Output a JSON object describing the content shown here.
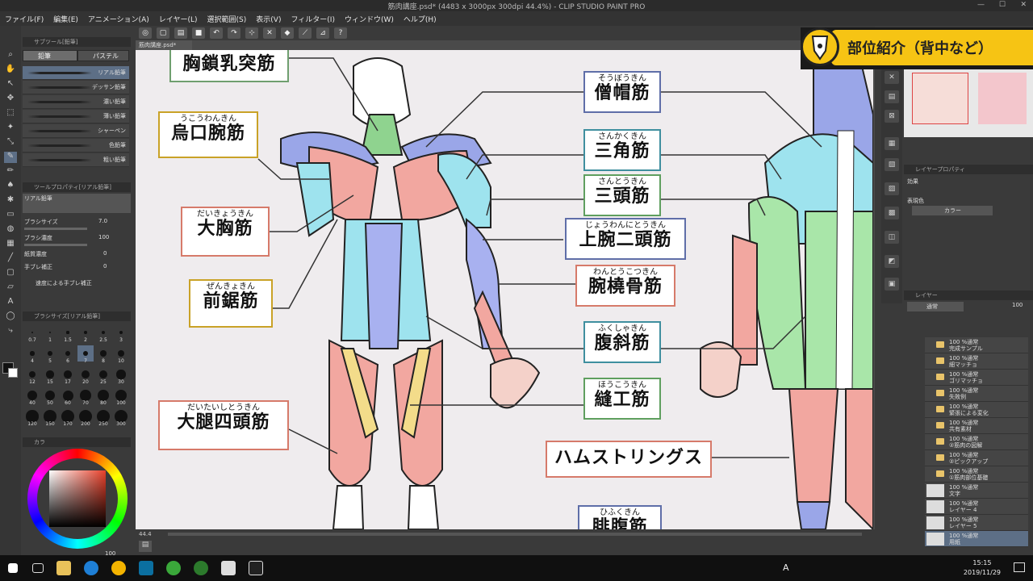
{
  "window": {
    "title": "筋肉講座.psd* (4483 x 3000px 300dpi 44.4%) - CLIP STUDIO PAINT PRO",
    "controls": [
      "—",
      "☐",
      "✕"
    ]
  },
  "menu": [
    "ファイル(F)",
    "編集(E)",
    "アニメーション(A)",
    "レイヤー(L)",
    "選択範囲(S)",
    "表示(V)",
    "フィルター(I)",
    "ウィンドウ(W)",
    "ヘルプ(H)"
  ],
  "subtool_panel": {
    "header": "サブツール[鉛筆]",
    "tabs": [
      "鉛筆",
      "パステル"
    ],
    "brushes": [
      "リアル鉛筆",
      "デッサン鉛筆",
      "濃い鉛筆",
      "薄い鉛筆",
      "シャーペン",
      "色鉛筆",
      "粗い鉛筆"
    ],
    "selected_brush": 0
  },
  "tool_property": {
    "header": "ツールプロパティ[リアル鉛筆]",
    "brush_name": "リアル鉛筆",
    "props": [
      {
        "label": "ブラシサイズ",
        "value": "7.0"
      },
      {
        "label": "ブラシ濃度",
        "value": "100"
      },
      {
        "label": "紙質濃度",
        "value": "0"
      },
      {
        "label": "手ブレ補正",
        "value": "0"
      }
    ],
    "checkbox_label": "速度による手ブレ補正"
  },
  "brush_size": {
    "header": "ブラシサイズ[リアル鉛筆]",
    "sizes": [
      "0.7",
      "1",
      "1.5",
      "2",
      "2.5",
      "3",
      "4",
      "5",
      "6",
      "7",
      "8",
      "10",
      "12",
      "15",
      "17",
      "20",
      "25",
      "30",
      "40",
      "50",
      "60",
      "70",
      "80",
      "100",
      "120",
      "150",
      "170",
      "200",
      "250",
      "300"
    ],
    "selected_index": 9
  },
  "color_panel": {
    "header": "カラ",
    "opacity": "100"
  },
  "document_tab": "筋肉講座.psd*",
  "banner": {
    "text": "部位紹介（背中など）"
  },
  "canvas": {
    "labels": [
      {
        "id": "kyosa",
        "ruby": "",
        "kanji": "胸鎖乳突筋",
        "color": "#6f9f6f"
      },
      {
        "id": "uko",
        "ruby": "うこうわんきん",
        "kanji": "烏口腕筋",
        "color": "#c9a227"
      },
      {
        "id": "daikyo",
        "ruby": "だいきょうきん",
        "kanji": "大胸筋",
        "color": "#d67a6a"
      },
      {
        "id": "zenkyo",
        "ruby": "ぜんきょきん",
        "kanji": "前鋸筋",
        "color": "#c9a227"
      },
      {
        "id": "daitai",
        "ruby": "だいたいしとうきん",
        "kanji": "大腿四頭筋",
        "color": "#d67a6a"
      },
      {
        "id": "sobo",
        "ruby": "そうぼうきん",
        "kanji": "僧帽筋",
        "color": "#5f6ea8"
      },
      {
        "id": "sankaku",
        "ruby": "さんかくきん",
        "kanji": "三角筋",
        "color": "#3f8f9f"
      },
      {
        "id": "santo",
        "ruby": "さんとうきん",
        "kanji": "三頭筋",
        "color": "#5f9f5f"
      },
      {
        "id": "jowan",
        "ruby": "じょうわんにとうきん",
        "kanji": "上腕二頭筋",
        "color": "#5f6ea8"
      },
      {
        "id": "wanto",
        "ruby": "わんとうこつきん",
        "kanji": "腕橈骨筋",
        "color": "#d67a6a"
      },
      {
        "id": "fukusha",
        "ruby": "ふくしゃきん",
        "kanji": "腹斜筋",
        "color": "#3f8f9f"
      },
      {
        "id": "hoko",
        "ruby": "ほうこうきん",
        "kanji": "縫工筋",
        "color": "#5f9f5f"
      },
      {
        "id": "ham",
        "ruby": "",
        "kanji": "ハムストリングス",
        "color": "#d67a6a"
      },
      {
        "id": "hifuku",
        "ruby": "ひふくきん",
        "kanji": "腓腹筋",
        "color": "#5f6ea8"
      }
    ]
  },
  "layer_property": {
    "header": "レイヤープロパティ",
    "effect_label": "効果",
    "expression_label": "表現色",
    "expression_value": "カラー"
  },
  "layers_panel": {
    "header": "レイヤー",
    "blend": "通常",
    "opacity": "100",
    "rows": [
      {
        "l1": "100 %通常",
        "l2": "完成サンプル",
        "type": "folder"
      },
      {
        "l1": "100 %通常",
        "l2": "細マッチョ",
        "type": "folder"
      },
      {
        "l1": "100 %通常",
        "l2": "ゴリマッチョ",
        "type": "folder"
      },
      {
        "l1": "100 %通常",
        "l2": "失敗例",
        "type": "folder"
      },
      {
        "l1": "100 %通常",
        "l2": "緊張による変化",
        "type": "folder"
      },
      {
        "l1": "100 %通常",
        "l2": "共有素材",
        "type": "folder"
      },
      {
        "l1": "100 %通常",
        "l2": "②筋肉の図解",
        "type": "folder"
      },
      {
        "l1": "100 %通常",
        "l2": "②ピックアップ",
        "type": "folder"
      },
      {
        "l1": "100 %通常",
        "l2": "①筋肉部位基礎",
        "type": "folder"
      },
      {
        "l1": "100 %通常",
        "l2": "文字",
        "type": "layer"
      },
      {
        "l1": "100 %通常",
        "l2": "レイヤー 4",
        "type": "layer"
      },
      {
        "l1": "100 %通常",
        "l2": "レイヤー 5",
        "type": "layer"
      },
      {
        "l1": "100 %通常",
        "l2": "用紙",
        "type": "paper"
      }
    ]
  },
  "status": {
    "zoom": "44.4"
  },
  "taskbar": {
    "time": "15:15",
    "date": "2019/11/29",
    "ime": "A"
  }
}
